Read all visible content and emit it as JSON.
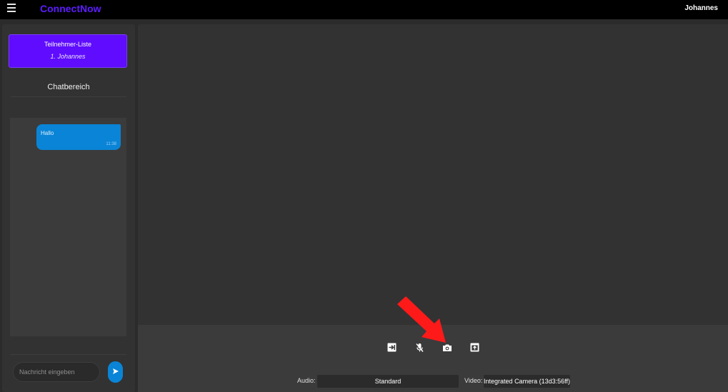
{
  "app": {
    "brand": "ConnectNow",
    "user": "Johannes",
    "brand_color": "#5d1cff"
  },
  "sidebar": {
    "participants_title": "Teilnehmer-Liste",
    "participants": [
      "1. Johannes"
    ],
    "chat_title": "Chatbereich",
    "messages": [
      {
        "text": "Hallo",
        "time": "11:38"
      }
    ],
    "input_placeholder": "Nachricht eingeben",
    "send_icon": "send-icon"
  },
  "controls": {
    "buttons": [
      {
        "name": "leave-button",
        "icon": "exit-icon"
      },
      {
        "name": "mute-button",
        "icon": "microphone-off-icon"
      },
      {
        "name": "snapshot-button",
        "icon": "camera-icon"
      },
      {
        "name": "share-screen-button",
        "icon": "screen-share-icon"
      }
    ],
    "audio_label": "Audio:",
    "audio_value": "Standard",
    "video_label": "Video:",
    "video_value": "Integrated Camera (13d3:56ff)"
  },
  "annotation": {
    "arrow_color": "#ff1a1a",
    "target": "snapshot-button"
  }
}
